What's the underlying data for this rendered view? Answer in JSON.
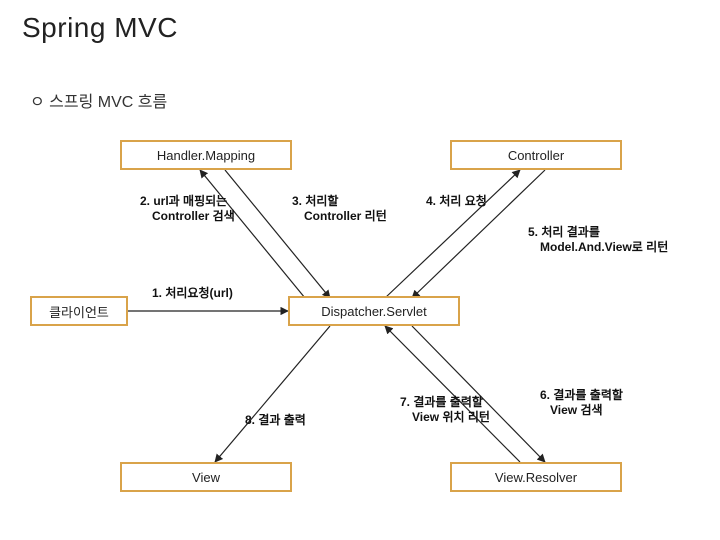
{
  "title": "Spring MVC",
  "subtitle": "ㅇ 스프링 MVC 흐름",
  "boxes": {
    "handler_mapping": "Handler.Mapping",
    "controller": "Controller",
    "client": "클라이언트",
    "dispatcher": "Dispatcher.Servlet",
    "view": "View",
    "view_resolver": "View.Resolver"
  },
  "labels": {
    "l1": "1. 처리요청(url)",
    "l2_a": "2. url과 매핑되는",
    "l2_b": "Controller 검색",
    "l3_a": "3. 처리할",
    "l3_b": "Controller 리턴",
    "l4": "4. 처리 요청",
    "l5_a": "5. 처리 결과를",
    "l5_b": "Model.And.View로 리턴",
    "l6_a": "6. 결과를 출력할",
    "l6_b": "View 검색",
    "l7_a": "7. 결과를 출력할",
    "l7_b": "View 위치 리턴",
    "l8": "8. 결과 출력"
  }
}
